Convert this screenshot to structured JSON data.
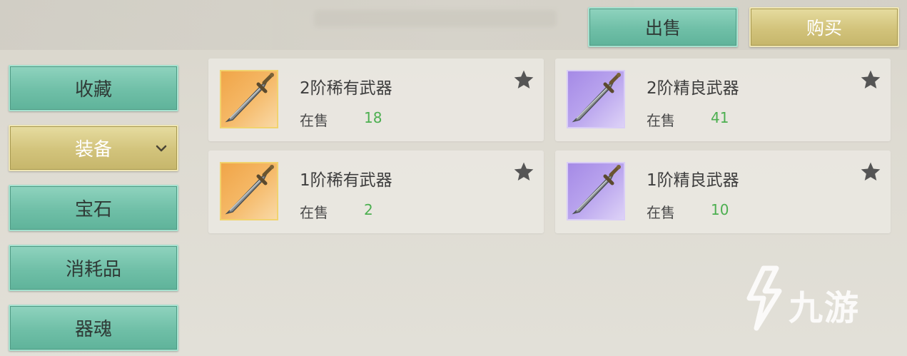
{
  "toolbar": {
    "sell_label": "出售",
    "buy_label": "购买"
  },
  "sidebar": {
    "items": [
      {
        "label": "收藏",
        "state": "normal"
      },
      {
        "label": "装备",
        "state": "selected",
        "icon": "chevron-down-icon"
      },
      {
        "label": "宝石",
        "state": "normal"
      },
      {
        "label": "消耗品",
        "state": "normal"
      },
      {
        "label": "器魂",
        "state": "normal"
      }
    ]
  },
  "items": [
    {
      "name": "2阶稀有武器",
      "sale_label": "在售",
      "count": "18",
      "rarity": "rare",
      "icon": "sword-icon"
    },
    {
      "name": "2阶精良武器",
      "sale_label": "在售",
      "count": "41",
      "rarity": "fine",
      "icon": "sword-icon"
    },
    {
      "name": "1阶稀有武器",
      "sale_label": "在售",
      "count": "2",
      "rarity": "rare",
      "icon": "sword-icon"
    },
    {
      "name": "1阶精良武器",
      "sale_label": "在售",
      "count": "10",
      "rarity": "fine",
      "icon": "sword-icon"
    }
  ],
  "watermark": {
    "text": "九游"
  },
  "colors": {
    "teal": "#6fbfa7",
    "gold": "#d2c37b",
    "rare": "#f0a548",
    "fine": "#a58ae6",
    "count": "#4caf50"
  }
}
